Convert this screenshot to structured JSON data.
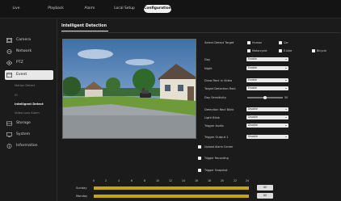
{
  "nav": {
    "items": [
      "Live",
      "Playback",
      "Alarm",
      "Local Setup",
      "Configuration"
    ],
    "active": "Configuration"
  },
  "sidebar": {
    "items": [
      {
        "label": "Camera",
        "icon": "camera-icon"
      },
      {
        "label": "Network",
        "icon": "network-icon"
      },
      {
        "label": "PTZ",
        "icon": "ptz-icon"
      },
      {
        "label": "Event",
        "icon": "event-icon",
        "active": true
      },
      {
        "label": "Storage",
        "icon": "storage-icon"
      },
      {
        "label": "System",
        "icon": "system-icon"
      },
      {
        "label": "Information",
        "icon": "information-icon"
      }
    ],
    "event_sub": [
      "Motion Detect",
      "IO",
      "Intelligent Detect",
      "Video Loss Alarm"
    ],
    "event_sub_active": "Intelligent Detect"
  },
  "page": {
    "title": "Intelligent Detection"
  },
  "detect": {
    "target_label": "Select Detect Target",
    "targets": [
      "Human",
      "Car",
      "Motorcycle",
      "E-bike",
      "Bicycle"
    ],
    "day_label": "Day",
    "day_value": "Enable",
    "night_label": "Night",
    "night_value": "Enable",
    "draw_label": "Draw Rect in Video",
    "draw_value": "Enable",
    "target_rect_label": "Target Detection Rect",
    "target_rect_value": "Enable",
    "sens_label": "Day Sensitivity",
    "sens_value": "50",
    "blink_label": "Detection Rect Blink",
    "blink_value": "Disable",
    "light_label": "Light Blink",
    "light_value": "Disable",
    "audio_label": "Trigger Audio",
    "audio_value": "Disable",
    "output_label": "Trigger Output 1",
    "output_value": "Disable",
    "upload": "Upload Alarm Center",
    "recording": "Trigger Recording",
    "snapshot": "Trigger Snapshot"
  },
  "schedule": {
    "hours": [
      "0",
      "2",
      "4",
      "6",
      "8",
      "10",
      "12",
      "14",
      "16",
      "18",
      "20",
      "22",
      "24"
    ],
    "days": [
      "Sunday",
      "Monday"
    ],
    "all_label": "All",
    "bar_color": "#c8a414"
  }
}
